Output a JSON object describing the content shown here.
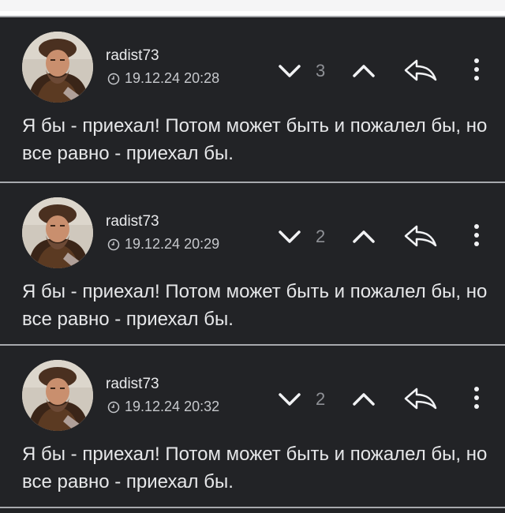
{
  "comments": [
    {
      "author": "radist73",
      "timestamp": "19.12.24 20:28",
      "score": "3",
      "text": "Я бы - приехал! Потом может быть и пожалел бы, но все равно - приехал бы.",
      "avatar_icon": "user-avatar-photo",
      "clock_icon": "clock-icon",
      "downvote_icon": "chevron-down-icon",
      "upvote_icon": "chevron-up-icon",
      "reply_icon": "reply-arrow-icon",
      "more_icon": "more-vertical-icon"
    },
    {
      "author": "radist73",
      "timestamp": "19.12.24 20:29",
      "score": "2",
      "text": "Я бы - приехал! Потом может быть и пожалел бы, но все равно - приехал бы.",
      "avatar_icon": "user-avatar-photo",
      "clock_icon": "clock-icon",
      "downvote_icon": "chevron-down-icon",
      "upvote_icon": "chevron-up-icon",
      "reply_icon": "reply-arrow-icon",
      "more_icon": "more-vertical-icon"
    },
    {
      "author": "radist73",
      "timestamp": "19.12.24 20:32",
      "score": "2",
      "text": "Я бы - приехал! Потом может быть и пожалел бы, но все равно - приехал бы.",
      "avatar_icon": "user-avatar-photo",
      "clock_icon": "clock-icon",
      "downvote_icon": "chevron-down-icon",
      "upvote_icon": "chevron-up-icon",
      "reply_icon": "reply-arrow-icon",
      "more_icon": "more-vertical-icon"
    }
  ],
  "colors": {
    "background": "#222326",
    "divider": "#a7a9ad",
    "text": "#e6e7e9",
    "muted": "#8f9196"
  }
}
